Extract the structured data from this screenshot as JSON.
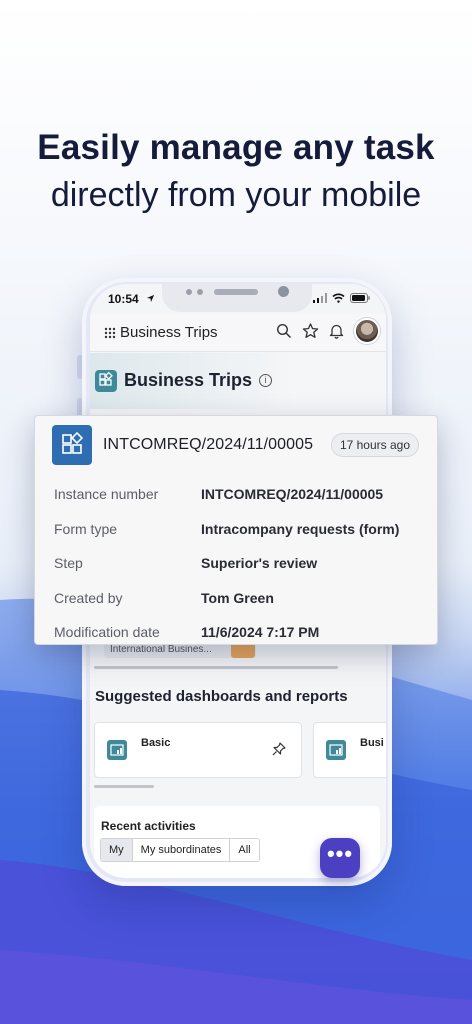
{
  "headline": {
    "line1": "Easily manage any task",
    "line2": "directly from your mobile"
  },
  "status_bar": {
    "time": "10:54"
  },
  "app_bar": {
    "title": "Business Trips"
  },
  "page_header": {
    "title": "Business Trips",
    "info_glyph": "i"
  },
  "popup": {
    "title": "INTCOMREQ/2024/11/00005",
    "age_badge": "17 hours ago",
    "rows": [
      {
        "label": "Instance number",
        "value": "INTCOMREQ/2024/11/00005"
      },
      {
        "label": "Form type",
        "value": "Intracompany requests (form)"
      },
      {
        "label": "Step",
        "value": "Superior's review"
      },
      {
        "label": "Created by",
        "value": "Tom Green"
      },
      {
        "label": "Modification date",
        "value": "11/6/2024 7:17 PM"
      }
    ]
  },
  "behind_row": {
    "text": "International Busines..."
  },
  "dashboards": {
    "title": "Suggested dashboards and reports",
    "cards": [
      {
        "label": "Basic"
      },
      {
        "label": "Busi"
      }
    ]
  },
  "recent": {
    "title": "Recent activities",
    "segments": [
      {
        "label": "My",
        "active": true
      },
      {
        "label": "My subordinates",
        "active": false
      },
      {
        "label": "All",
        "active": false
      }
    ]
  },
  "fab": {
    "glyph": "•••"
  },
  "colors": {
    "headline": "#151b3a",
    "teal_icon": "#3e8a9a",
    "popup_icon": "#2f6db3",
    "fab": "#4d3fc2",
    "orange_tag": "#e7a55a"
  },
  "icons": [
    "app-grid-icon",
    "search-icon",
    "star-icon",
    "bell-icon",
    "avatar",
    "info-icon",
    "widgets-icon",
    "dashboard-icon",
    "pin-icon",
    "more-icon",
    "signal-icon",
    "wifi-icon",
    "battery-icon",
    "location-arrow-icon"
  ]
}
